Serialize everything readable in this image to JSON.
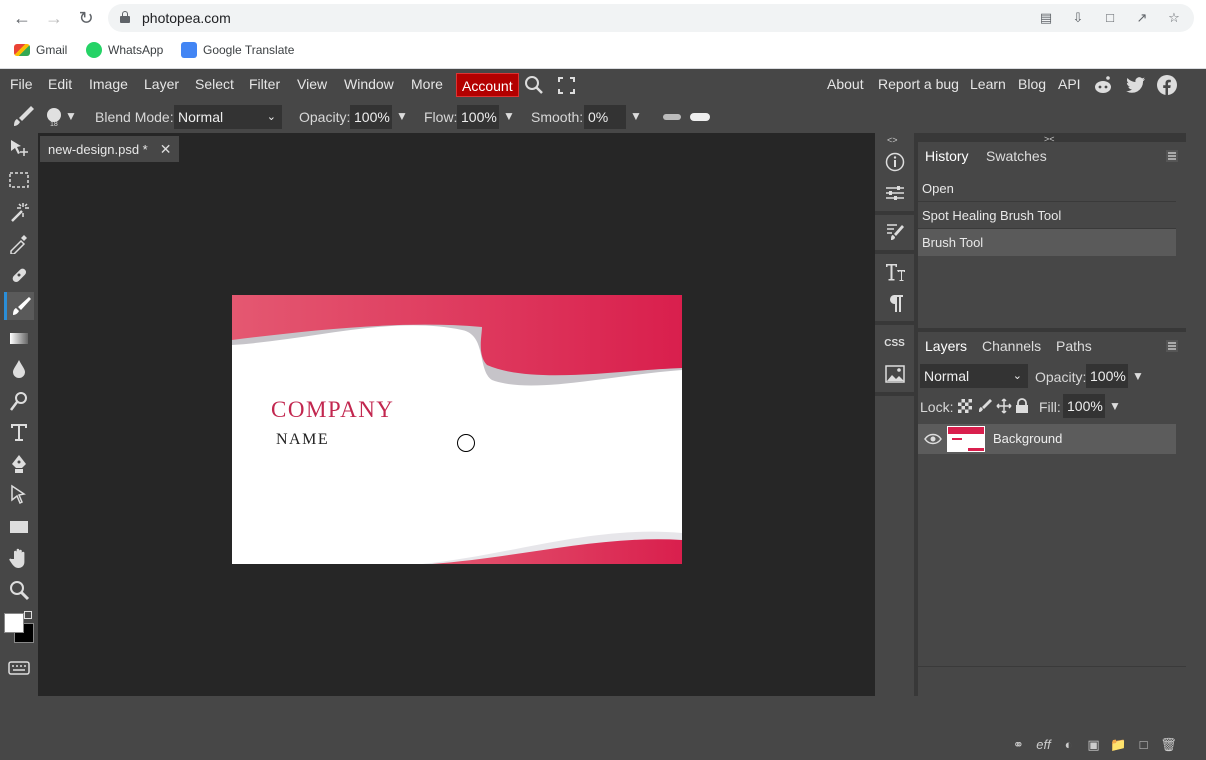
{
  "browser": {
    "url": "photopea.com",
    "bookmarks": [
      "Gmail",
      "WhatsApp",
      "Google Translate"
    ]
  },
  "menu": {
    "items": [
      "File",
      "Edit",
      "Image",
      "Layer",
      "Select",
      "Filter",
      "View",
      "Window",
      "More"
    ],
    "account": "Account",
    "right_links": [
      "About",
      "Report a bug",
      "Learn",
      "Blog",
      "API"
    ]
  },
  "tool_options": {
    "brush_size": "18",
    "blend_label": "Blend Mode:",
    "blend_value": "Normal",
    "opacity_label": "Opacity:",
    "opacity_value": "100%",
    "flow_label": "Flow:",
    "flow_value": "100%",
    "smooth_label": "Smooth:",
    "smooth_value": "0%"
  },
  "document": {
    "tab_title": "new-design.psd *",
    "company": "COMPANY",
    "name": "NAME",
    "accent_color": "#d91f4d",
    "wave_gray": "#c6c4c9"
  },
  "history": {
    "tabs": [
      "History",
      "Swatches"
    ],
    "items": [
      "Open",
      "Spot Healing Brush Tool",
      "Brush Tool"
    ]
  },
  "layers": {
    "tabs": [
      "Layers",
      "Channels",
      "Paths"
    ],
    "blend_value": "Normal",
    "opacity_label": "Opacity:",
    "opacity_value": "100%",
    "lock_label": "Lock:",
    "fill_label": "Fill:",
    "fill_value": "100%",
    "layer_name": "Background"
  },
  "side_strip": {
    "css_label": "CSS"
  }
}
